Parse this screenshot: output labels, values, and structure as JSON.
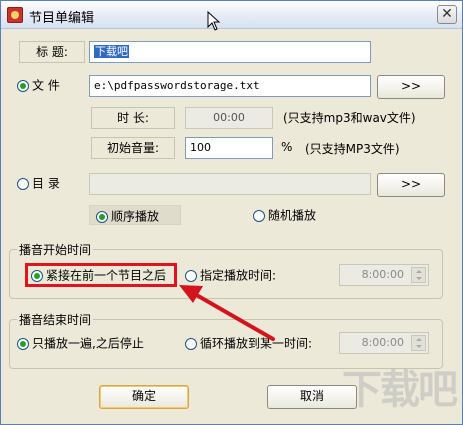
{
  "window": {
    "title": "节目单编辑",
    "close_glyph": "✕"
  },
  "title_field": {
    "label": "标  题:",
    "value": "下载吧"
  },
  "file": {
    "label": "文  件",
    "path": "e:\\pdfpasswordstorage.txt",
    "browse": ">>"
  },
  "duration": {
    "label": "时  长:",
    "value": "00:00",
    "note": "(只支持mp3和wav文件)"
  },
  "volume": {
    "label": "初始音量:",
    "value": "100",
    "unit": "%",
    "note": "(只支持MP3文件)"
  },
  "directory": {
    "label": "目  录",
    "value": "",
    "browse": ">>"
  },
  "order": {
    "sequential": "顺序播放",
    "random": "随机播放"
  },
  "start_group": {
    "title": "播音开始时间",
    "after_previous": "紧接在前一个节目之后",
    "specified": "指定播放时间:",
    "time": "8:00:00"
  },
  "end_group": {
    "title": "播音结束时间",
    "play_once": "只播放一遍,之后停止",
    "loop": "循环播放到某一时间:",
    "time": "8:00:00"
  },
  "buttons": {
    "ok": "确定",
    "cancel": "取消"
  },
  "watermark": "下载吧",
  "colors": {
    "highlight_red": "#e0141c",
    "arrow_red": "#d4141c",
    "selection_blue": "#316ac5"
  }
}
